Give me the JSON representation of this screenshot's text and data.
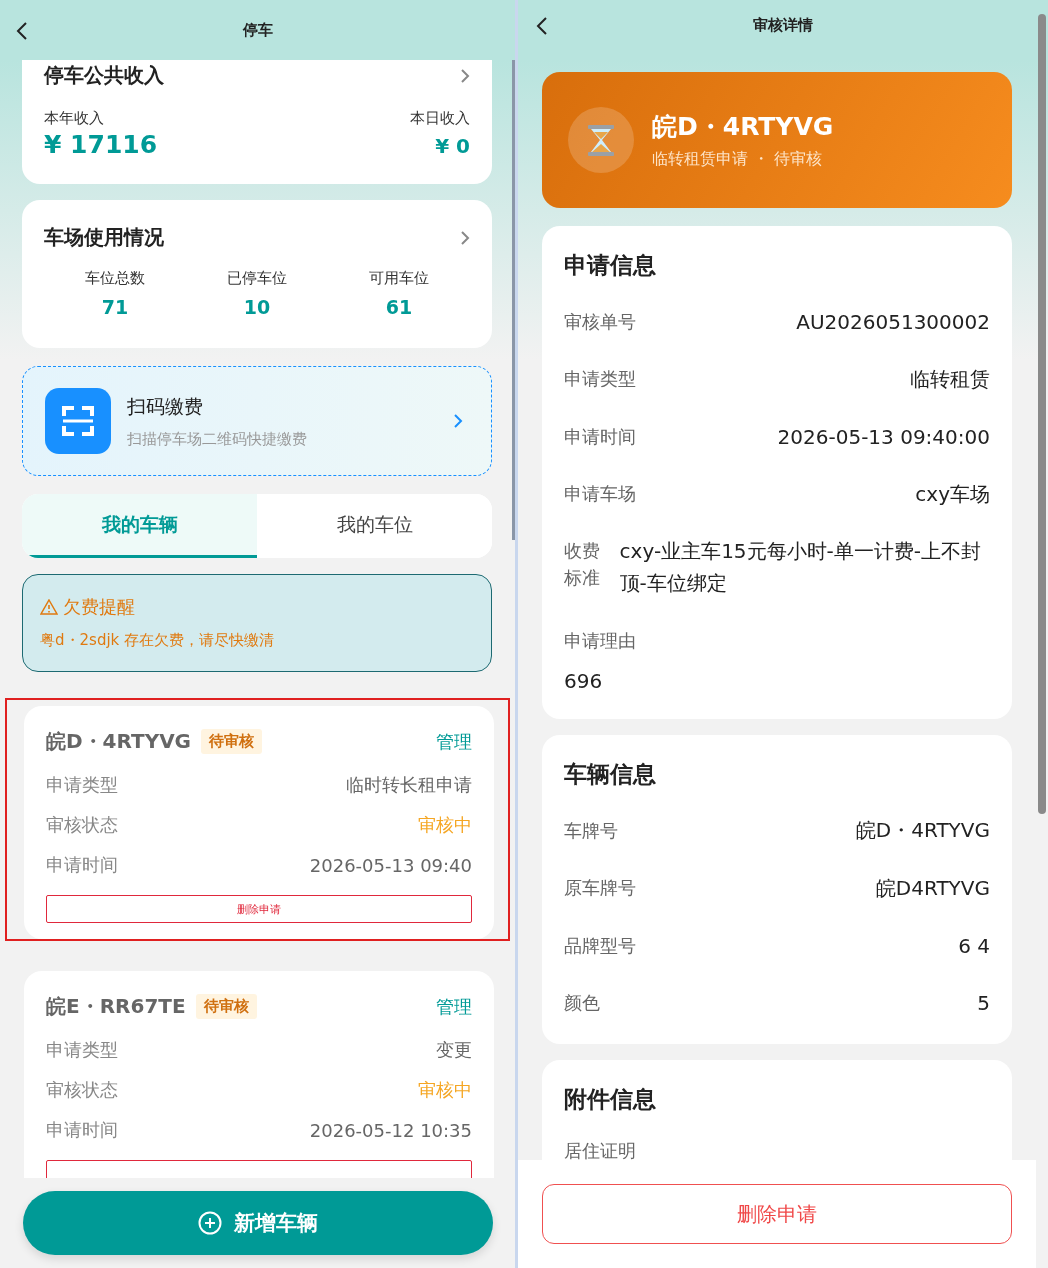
{
  "left": {
    "header": {
      "title": "停车"
    },
    "income": {
      "title": "停车公共收入",
      "year_label": "本年收入",
      "year_value": "¥ 17116",
      "day_label": "本日收入",
      "day_value": "¥ 0"
    },
    "usage": {
      "title": "车场使用情况",
      "stats": [
        {
          "label": "车位总数",
          "value": "71"
        },
        {
          "label": "已停车位",
          "value": "10"
        },
        {
          "label": "可用车位",
          "value": "61"
        }
      ]
    },
    "scan": {
      "title": "扫码缴费",
      "subtitle": "扫描停车场二维码快捷缴费"
    },
    "tabs": [
      {
        "label": "我的车辆",
        "selected": true
      },
      {
        "label": "我的车位",
        "selected": false
      }
    ],
    "alert": {
      "title": "欠费提醒",
      "message": "粤d・2sdjk 存在欠费，请尽快缴清"
    },
    "vehicles": [
      {
        "plate": "皖D・4RTYVG",
        "badge": "待审核",
        "action": "管理",
        "selected": true,
        "delete_label": "删除申请",
        "rows": [
          {
            "label": "申请类型",
            "value": "临时转长租申请",
            "kind": "plain"
          },
          {
            "label": "审核状态",
            "value": "审核中",
            "kind": "status"
          },
          {
            "label": "申请时间",
            "value": "2026-05-13 09:40",
            "kind": "plain"
          }
        ]
      },
      {
        "plate": "皖E・RR67TE",
        "badge": "待审核",
        "action": "管理",
        "selected": false,
        "rows": [
          {
            "label": "申请类型",
            "value": "变更",
            "kind": "plain"
          },
          {
            "label": "审核状态",
            "value": "审核中",
            "kind": "status"
          },
          {
            "label": "申请时间",
            "value": "2026-05-12 10:35",
            "kind": "plain"
          }
        ]
      }
    ],
    "add_button": "新增车辆"
  },
  "right": {
    "header": {
      "title": "审核详情"
    },
    "banner": {
      "plate": "皖D・4RTYVG",
      "subtitle": "临转租赁申请 ・ 待审核"
    },
    "sections": [
      {
        "title": "申请信息",
        "rows": [
          {
            "label": "审核单号",
            "value": "AU2026051300002",
            "kind": "inline"
          },
          {
            "label": "申请类型",
            "value": "临转租赁",
            "kind": "inline"
          },
          {
            "label": "申请时间",
            "value": "2026-05-13 09:40:00",
            "kind": "inline"
          },
          {
            "label": "申请车场",
            "value": "cxy车场",
            "kind": "inline"
          },
          {
            "label": "收费标准",
            "value": "cxy-业主车15元每小时-单一计费-上不封顶-车位绑定",
            "kind": "side"
          },
          {
            "label": "申请理由",
            "value": "696",
            "kind": "stacked"
          }
        ]
      },
      {
        "title": "车辆信息",
        "rows": [
          {
            "label": "车牌号",
            "value": "皖D・4RTYVG",
            "kind": "inline"
          },
          {
            "label": "原车牌号",
            "value": "皖D4RTYVG",
            "kind": "inline"
          },
          {
            "label": "品牌型号",
            "value": "6 4",
            "kind": "inline"
          },
          {
            "label": "颜色",
            "value": "5",
            "kind": "inline"
          }
        ]
      },
      {
        "title": "附件信息",
        "rows": [
          {
            "label": "居住证明",
            "kind": "stacked"
          }
        ]
      }
    ],
    "delete_button": "删除申请"
  }
}
